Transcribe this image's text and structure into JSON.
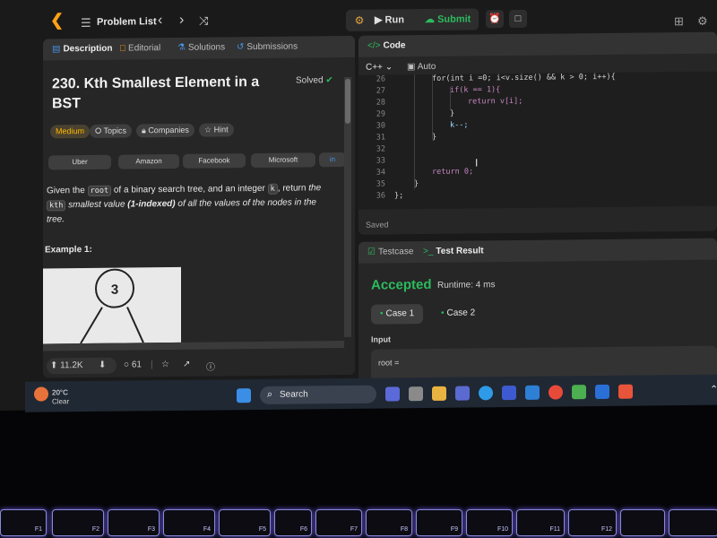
{
  "nav": {
    "problem_list": "Problem List",
    "run": "Run",
    "submit": "Submit"
  },
  "tabs": {
    "description": "Description",
    "editorial": "Editorial",
    "solutions": "Solutions",
    "submissions": "Submissions"
  },
  "problem": {
    "title": "230. Kth Smallest Element in a BST",
    "status": "Solved",
    "difficulty": "Medium",
    "tags": [
      "Topics",
      "Companies",
      "Hint"
    ],
    "companies": [
      "Uber",
      "Amazon",
      "Facebook",
      "Microsoft",
      "in"
    ],
    "desc_1": "Given the",
    "desc_code1": "root",
    "desc_2": "of a binary search tree, and an integer",
    "desc_code2": "k",
    "desc_3": ", return",
    "desc_4": "the",
    "desc_code3": "kth",
    "desc_5": "smallest value",
    "desc_6": "(1-indexed)",
    "desc_7": "of all the values of the nodes in the tree.",
    "example_title": "Example 1:",
    "tree_node": "3"
  },
  "stats": {
    "likes": "11.2K",
    "comments": "61"
  },
  "code": {
    "header": "Code",
    "lang": "C++",
    "autosave": "Auto",
    "saved": "Saved",
    "lines": [
      {
        "n": "26",
        "t": "for(int i =0; i<v.size() && k > 0; i++){"
      },
      {
        "n": "27",
        "t": "if(k == 1){"
      },
      {
        "n": "28",
        "t": "return v[i];"
      },
      {
        "n": "29",
        "t": "}"
      },
      {
        "n": "30",
        "t": "k--;"
      },
      {
        "n": "31",
        "t": "}"
      },
      {
        "n": "32",
        "t": ""
      },
      {
        "n": "33",
        "t": ""
      },
      {
        "n": "34",
        "t": "return 0;"
      },
      {
        "n": "35",
        "t": "}"
      },
      {
        "n": "36",
        "t": "};"
      }
    ]
  },
  "result": {
    "testcase_tab": "Testcase",
    "result_tab": "Test Result",
    "status": "Accepted",
    "runtime": "Runtime: 4 ms",
    "case1": "Case 1",
    "case2": "Case 2",
    "input_label": "Input",
    "input_value": "root ="
  },
  "taskbar": {
    "temp": "20°C",
    "condition": "Clear",
    "search": "Search"
  },
  "keyboard": [
    "F1",
    "F2",
    "F3",
    "F4",
    "F5",
    "F6",
    "F7",
    "F8",
    "F9",
    "F10",
    "F11",
    "F12"
  ],
  "colors": {
    "accent_green": "#2cbb5d",
    "medium": "#ffb800",
    "brand_orange": "#ffa116"
  }
}
